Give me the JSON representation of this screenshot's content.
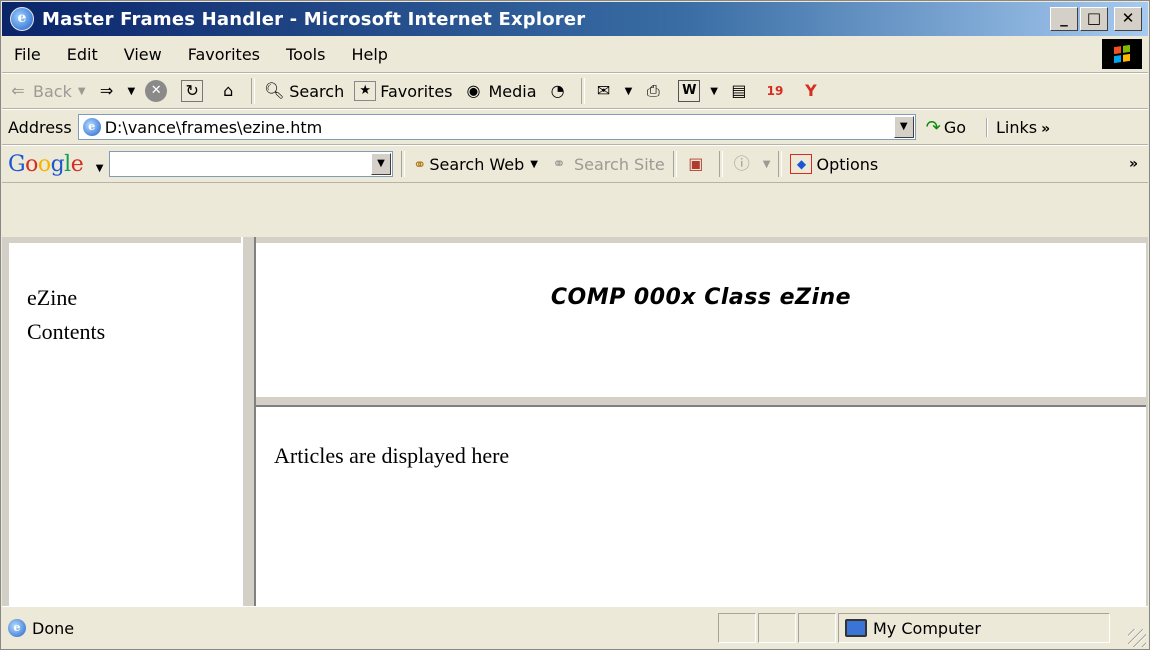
{
  "window": {
    "title": "Master Frames Handler - Microsoft Internet Explorer",
    "controls": {
      "minimize": "_",
      "maximize": "□",
      "close": "✕"
    }
  },
  "menu": [
    "File",
    "Edit",
    "View",
    "Favorites",
    "Tools",
    "Help"
  ],
  "toolbar": {
    "back": "Back",
    "search": "Search",
    "favorites": "Favorites",
    "media": "Media"
  },
  "address": {
    "label": "Address",
    "url": "D:\\vance\\frames\\ezine.htm",
    "go": "Go",
    "links": "Links"
  },
  "google": {
    "logo": {
      "G": "G",
      "o1": "o",
      "o2": "o",
      "g": "g",
      "l": "l",
      "e": "e"
    },
    "search_value": "",
    "search_web": "Search Web",
    "search_site": "Search Site",
    "options": "Options"
  },
  "frames": {
    "left_line1": "eZine",
    "left_line2": "Contents",
    "top_title": "COMP 000x Class eZine",
    "main_text": "Articles are displayed here"
  },
  "status": {
    "text": "Done",
    "zone": "My Computer"
  }
}
